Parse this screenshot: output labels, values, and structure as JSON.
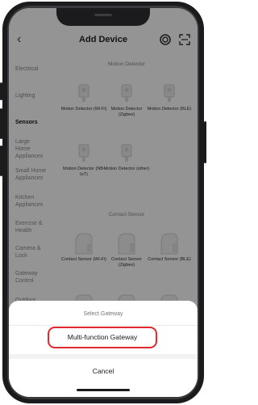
{
  "header": {
    "title": "Add Device",
    "back_icon": "chevron-left-icon",
    "icons": [
      "scan-target-icon",
      "qr-scan-icon"
    ]
  },
  "sidebar": {
    "items": [
      {
        "label": "Electrical",
        "active": false
      },
      {
        "label": "Lighting",
        "active": false
      },
      {
        "label": "Sensors",
        "active": true
      },
      {
        "label": "Large Home Appliances",
        "active": false
      },
      {
        "label": "Small Home Appliances",
        "active": false
      },
      {
        "label": "Kitchen Appliances",
        "active": false
      },
      {
        "label": "Exercise & Health",
        "active": false
      },
      {
        "label": "Camera & Lock",
        "active": false
      },
      {
        "label": "Gateway Control",
        "active": false
      },
      {
        "label": "Outdoor Travel",
        "active": false
      }
    ]
  },
  "content": {
    "sections": [
      {
        "title": "Motion Detector",
        "devices": [
          {
            "label": "Motion Detector (Wi-Fi)",
            "icon": "motion-detector-icon"
          },
          {
            "label": "Motion Detector (Zigbee)",
            "icon": "motion-detector-icon"
          },
          {
            "label": "Motion Detector (BLE)",
            "icon": "motion-detector-icon"
          },
          {
            "label": "Motion Detector (NB-IoT)",
            "icon": "motion-detector-icon"
          },
          {
            "label": "Motion Detector (other)",
            "icon": "motion-detector-icon"
          }
        ]
      },
      {
        "title": "Contact Sensor",
        "devices": [
          {
            "label": "Contact Sensor (Wi-Fi)",
            "icon": "contact-sensor-icon"
          },
          {
            "label": "Contact Sensor (Zigbee)",
            "icon": "contact-sensor-icon"
          },
          {
            "label": "Contact Sensor (BLE)",
            "icon": "contact-sensor-icon"
          }
        ]
      }
    ]
  },
  "sheet": {
    "title": "Select Gateway",
    "option": "Multi-function Gateway",
    "cancel": "Cancel"
  },
  "colors": {
    "highlight_border": "#e0282e",
    "overlay": "rgba(0,0,0,0.42)",
    "phone_frame": "#1b1b1d"
  }
}
